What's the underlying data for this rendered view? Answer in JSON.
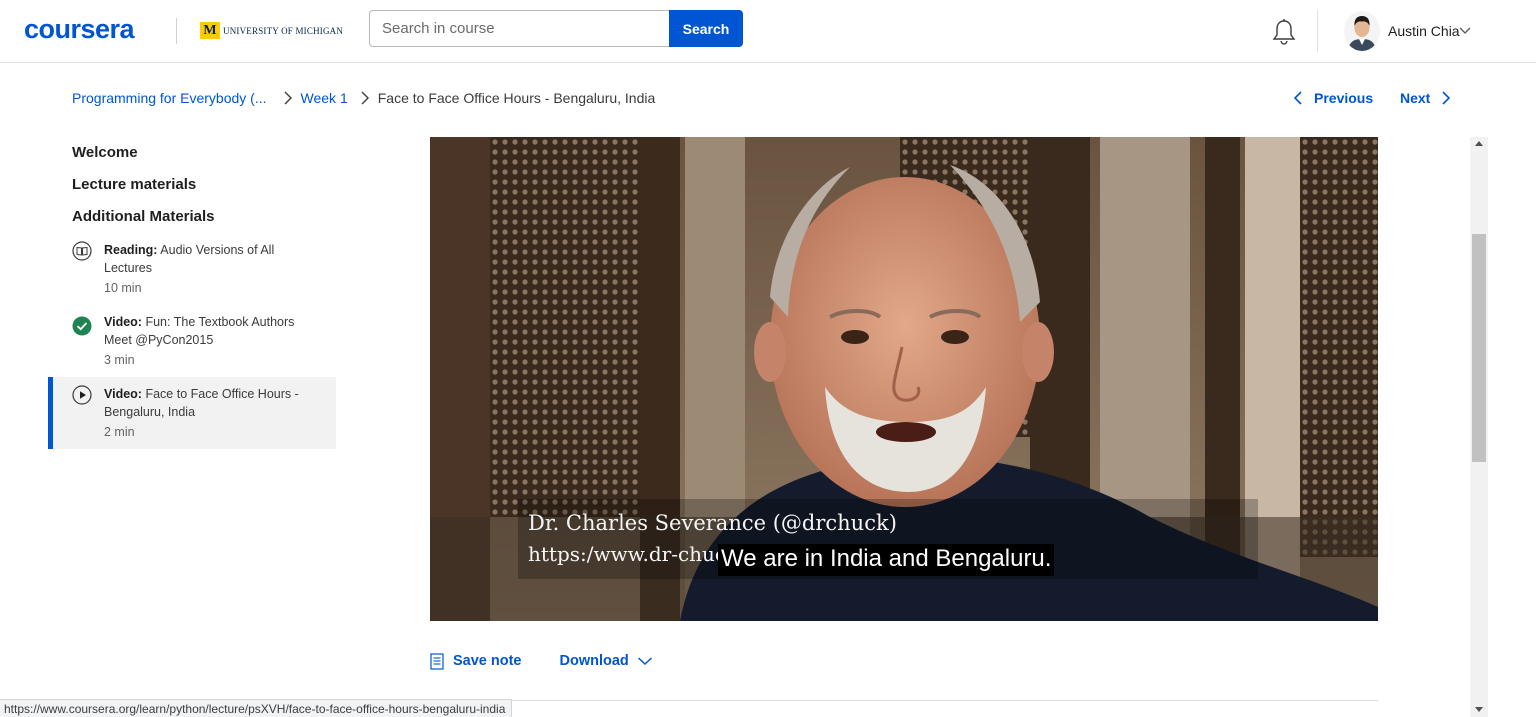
{
  "header": {
    "logo": "coursera",
    "university": "UNIVERSITY OF MICHIGAN",
    "university_mark": "M",
    "search_placeholder": "Search in course",
    "search_button": "Search",
    "user_name": "Austin Chia"
  },
  "breadcrumb": {
    "course": "Programming for Everybody (...",
    "week": "Week 1",
    "current": "Face to Face Office Hours - Bengaluru, India"
  },
  "nav": {
    "previous": "Previous",
    "next": "Next"
  },
  "sidebar": {
    "headings": [
      "Welcome",
      "Lecture materials",
      "Additional Materials"
    ],
    "items": [
      {
        "type": "Reading:",
        "title": "Audio Versions of All Lectures",
        "duration": "10 min",
        "icon": "book-icon",
        "status": "not-started"
      },
      {
        "type": "Video:",
        "title": "Fun: The Textbook Authors Meet @PyCon2015",
        "duration": "3 min",
        "icon": "check-circle-icon",
        "status": "completed"
      },
      {
        "type": "Video:",
        "title": "Face to Face Office Hours - Bengaluru, India",
        "duration": "2 min",
        "icon": "play-circle-icon",
        "status": "current"
      }
    ]
  },
  "video": {
    "overlay_name": "Dr. Charles Severance (@drchuck)",
    "overlay_url": "https:/www.dr-chuck.com/",
    "subtitle": "We are in India and Bengaluru."
  },
  "actions": {
    "save_note": "Save note",
    "download": "Download"
  },
  "statusbar": {
    "url": "https://www.coursera.org/learn/python/lecture/psXVH/face-to-face-office-hours-bengaluru-india"
  },
  "colors": {
    "brand": "#0056d2",
    "completed": "#1f8354",
    "active_bg": "#f2f2f2"
  }
}
